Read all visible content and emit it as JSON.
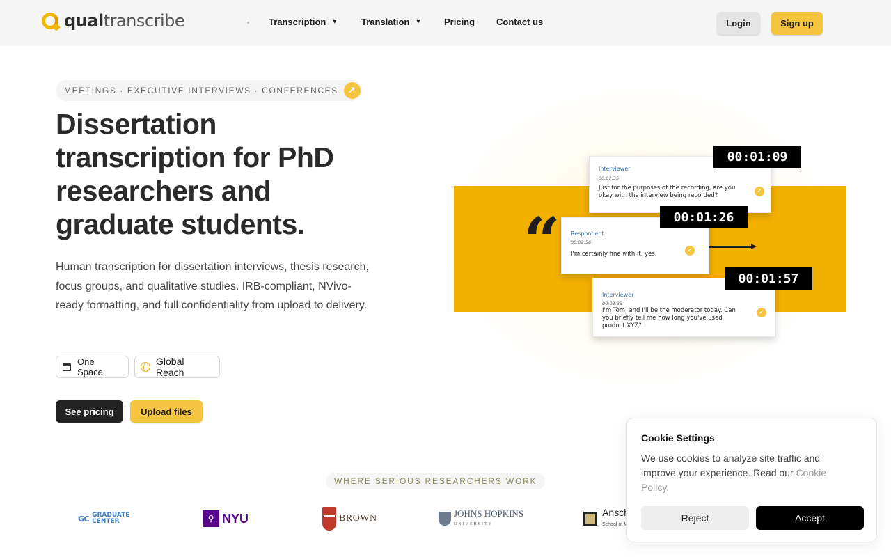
{
  "header": {
    "logo_bold": "qual",
    "logo_light": "transcribe",
    "nav": [
      {
        "label": "Transcription",
        "has_dropdown": true
      },
      {
        "label": "Translation",
        "has_dropdown": true
      },
      {
        "label": "Pricing",
        "has_dropdown": false
      },
      {
        "label": "Contact us",
        "has_dropdown": false
      }
    ],
    "login_label": "Login",
    "signup_label": "Sign up"
  },
  "hero": {
    "eyebrow": "MEETINGS · EXECUTIVE INTERVIEWS · CONFERENCES",
    "eyebrow_icon": "arrow-up-right-icon",
    "title": "Dissertation transcription for PhD researchers and graduate students.",
    "description": "Human transcription for dissertation interviews, thesis research, focus groups, and qualitative studies. IRB-compliant, NVivo-ready formatting, and full confidentiality from upload to delivery.",
    "badges": [
      {
        "label": "One Space",
        "icon": "calendar-icon"
      },
      {
        "label": "Global Reach",
        "icon": "globe-icon"
      }
    ],
    "pricing_label": "See pricing",
    "upload_label": "Upload files"
  },
  "illustration": {
    "quote_glyph": "“",
    "cards": [
      {
        "role": "Interviewer",
        "timestamp": "00:02:35",
        "text": "Just for the purposes of the recording, are you okay with the interview being recorded?"
      },
      {
        "role": "Respondent",
        "timestamp": "00:02:56",
        "text": "I'm certainly fine with it, yes."
      },
      {
        "role": "Interviewer",
        "timestamp": "00:03:33",
        "text": "I'm Tom, and I'll be the moderator today. Can you briefly tell me how long you've used product XYZ?"
      }
    ],
    "timers": [
      "00:01:09",
      "00:01:26",
      "00:01:57"
    ],
    "check_glyph": "✓"
  },
  "trusted": {
    "label": "WHERE SERIOUS RESEARCHERS WORK",
    "logos": {
      "gc_mark": "GC",
      "gc_line1": "GRADUATE",
      "gc_line2": "CENTER",
      "nyu_box": "⚲",
      "nyu_text": "NYU",
      "brown_text": "BROWN",
      "jh_text": "JOHNS HOPKINS",
      "jh_sub": "UNIVERSITY",
      "cu_text": "Ansch",
      "cu_sub": "School of M"
    }
  },
  "cookie": {
    "title": "Cookie Settings",
    "text": "We use cookies to analyze site traffic and improve your experience. Read our ",
    "link": "Cookie Policy",
    "period": ".",
    "reject_label": "Reject",
    "accept_label": "Accept"
  },
  "colors": {
    "accent": "#f5c542",
    "band": "#f2b000",
    "dark": "#232323"
  }
}
